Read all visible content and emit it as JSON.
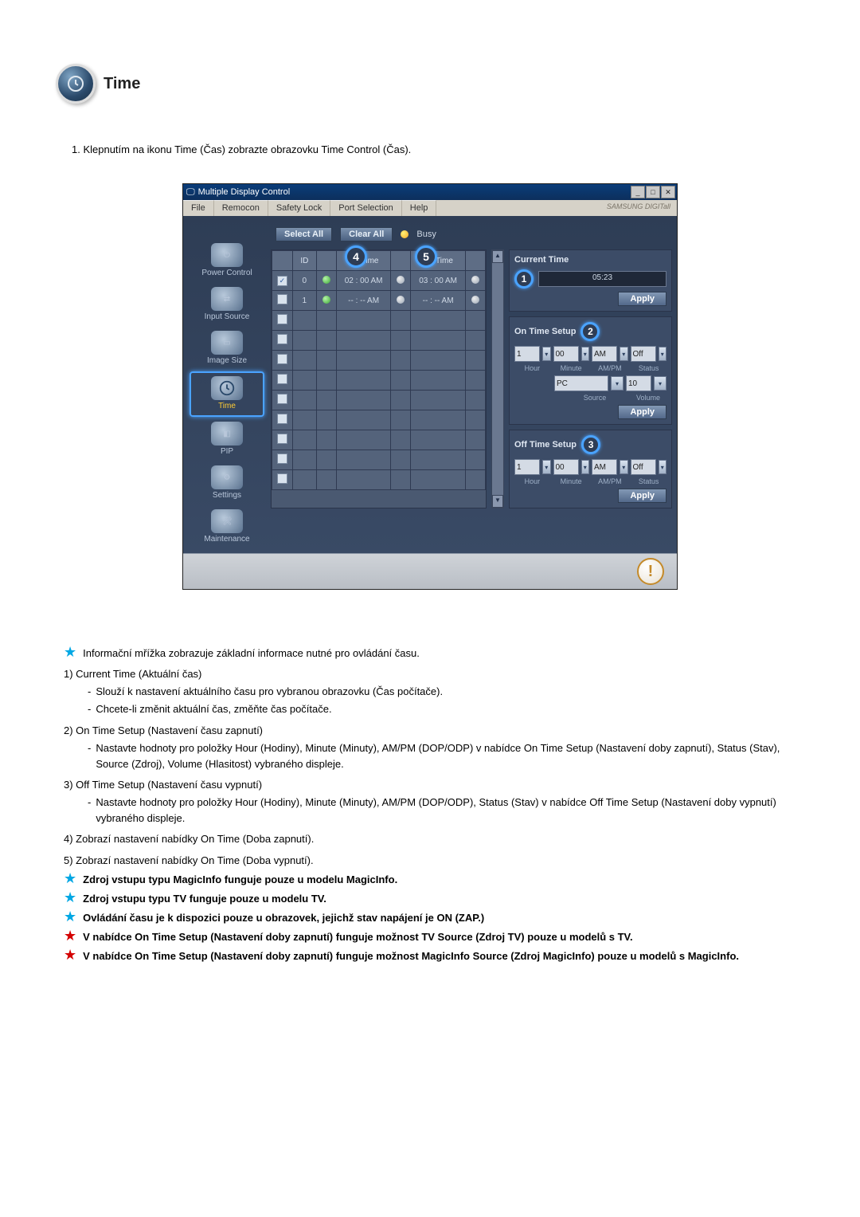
{
  "header": {
    "title": "Time"
  },
  "intro": "1. Klepnutím na ikonu Time (Čas) zobrazte obrazovku Time Control (Čas).",
  "app": {
    "title": "Multiple Display Control",
    "brand": "SAMSUNG DIGITall",
    "menu": [
      "File",
      "Remocon",
      "Safety Lock",
      "Port Selection",
      "Help"
    ],
    "toolbar": {
      "select_all": "Select All",
      "clear_all": "Clear All",
      "busy": "Busy"
    },
    "sidebar": [
      {
        "label": "Power Control"
      },
      {
        "label": "Input Source"
      },
      {
        "label": "Image Size"
      },
      {
        "label": "Time",
        "active": true
      },
      {
        "label": "PIP"
      },
      {
        "label": "Settings"
      },
      {
        "label": "Maintenance"
      }
    ],
    "grid": {
      "headers": [
        "",
        "ID",
        "",
        "On Time",
        "",
        "Off Time",
        ""
      ],
      "rows": [
        {
          "checked": true,
          "id": "0",
          "led1": "on",
          "on_time": "02 : 00 AM",
          "led2": "off",
          "off_time": "03 : 00 AM",
          "led3": "off"
        },
        {
          "checked": false,
          "id": "1",
          "led1": "on",
          "on_time": "-- : -- AM",
          "led2": "off",
          "off_time": "-- : -- AM",
          "led3": "off"
        },
        {
          "checked": false,
          "id": "",
          "led1": "",
          "on_time": "",
          "led2": "",
          "off_time": "",
          "led3": ""
        },
        {
          "checked": false,
          "id": "",
          "led1": "",
          "on_time": "",
          "led2": "",
          "off_time": "",
          "led3": ""
        },
        {
          "checked": false,
          "id": "",
          "led1": "",
          "on_time": "",
          "led2": "",
          "off_time": "",
          "led3": ""
        },
        {
          "checked": false,
          "id": "",
          "led1": "",
          "on_time": "",
          "led2": "",
          "off_time": "",
          "led3": ""
        },
        {
          "checked": false,
          "id": "",
          "led1": "",
          "on_time": "",
          "led2": "",
          "off_time": "",
          "led3": ""
        },
        {
          "checked": false,
          "id": "",
          "led1": "",
          "on_time": "",
          "led2": "",
          "off_time": "",
          "led3": ""
        },
        {
          "checked": false,
          "id": "",
          "led1": "",
          "on_time": "",
          "led2": "",
          "off_time": "",
          "led3": ""
        },
        {
          "checked": false,
          "id": "",
          "led1": "",
          "on_time": "",
          "led2": "",
          "off_time": "",
          "led3": ""
        },
        {
          "checked": false,
          "id": "",
          "led1": "",
          "on_time": "",
          "led2": "",
          "off_time": "",
          "led3": ""
        }
      ]
    },
    "callouts": {
      "c1": "1",
      "c2": "2",
      "c3": "3",
      "c4": "4",
      "c5": "5"
    },
    "current_time": {
      "title": "Current Time",
      "value": "05:23",
      "apply": "Apply"
    },
    "on_time": {
      "title": "On Time Setup",
      "hour": "1",
      "minute": "00",
      "ampm": "AM",
      "status": "Off",
      "source": "PC",
      "volume": "10",
      "labels": {
        "hour": "Hour",
        "minute": "Minute",
        "ampm": "AM/PM",
        "status": "Status",
        "source": "Source",
        "volume": "Volume"
      },
      "apply": "Apply"
    },
    "off_time": {
      "title": "Off Time Setup",
      "hour": "1",
      "minute": "00",
      "ampm": "AM",
      "status": "Off",
      "labels": {
        "hour": "Hour",
        "minute": "Minute",
        "ampm": "AM/PM",
        "status": "Status"
      },
      "apply": "Apply"
    }
  },
  "explain": {
    "star1": "Informační mřížka zobrazuje základní informace nutné pro ovládání času.",
    "n1_head": "1) Current Time (Aktuální čas)",
    "n1_a": "Slouží k nastavení aktuálního času pro vybranou obrazovku (Čas počítače).",
    "n1_b": "Chcete-li změnit aktuální čas, změňte čas počítače.",
    "n2_head": "2) On Time Setup (Nastavení času zapnutí)",
    "n2_a": "Nastavte hodnoty pro položky Hour (Hodiny), Minute (Minuty), AM/PM (DOP/ODP) v nabídce On Time Setup (Nastavení doby zapnutí), Status (Stav), Source (Zdroj), Volume (Hlasitost) vybraného displeje.",
    "n3_head": "3) Off Time Setup (Nastavení času vypnutí)",
    "n3_a": "Nastavte hodnoty pro položky Hour (Hodiny), Minute (Minuty), AM/PM (DOP/ODP), Status (Stav) v nabídce Off Time Setup (Nastavení doby vypnutí) vybraného displeje.",
    "n4": "4)  Zobrazí nastavení nabídky On Time (Doba zapnutí).",
    "n5": "5)  Zobrazí nastavení nabídky On Time (Doba vypnutí).",
    "star_b1": "Zdroj vstupu typu MagicInfo funguje pouze u modelu MagicInfo.",
    "star_b2": "Zdroj vstupu typu TV funguje pouze u modelu TV.",
    "star_b3": "Ovládání času je k dispozici pouze u obrazovek, jejichž stav napájení je ON (ZAP.)",
    "star_b4": "V nabídce On Time Setup (Nastavení doby zapnutí) funguje možnost TV Source (Zdroj TV) pouze u modelů s TV.",
    "star_b5": "V nabídce On Time Setup (Nastavení doby zapnutí) funguje možnost MagicInfo Source (Zdroj MagicInfo) pouze u modelů s MagicInfo."
  }
}
